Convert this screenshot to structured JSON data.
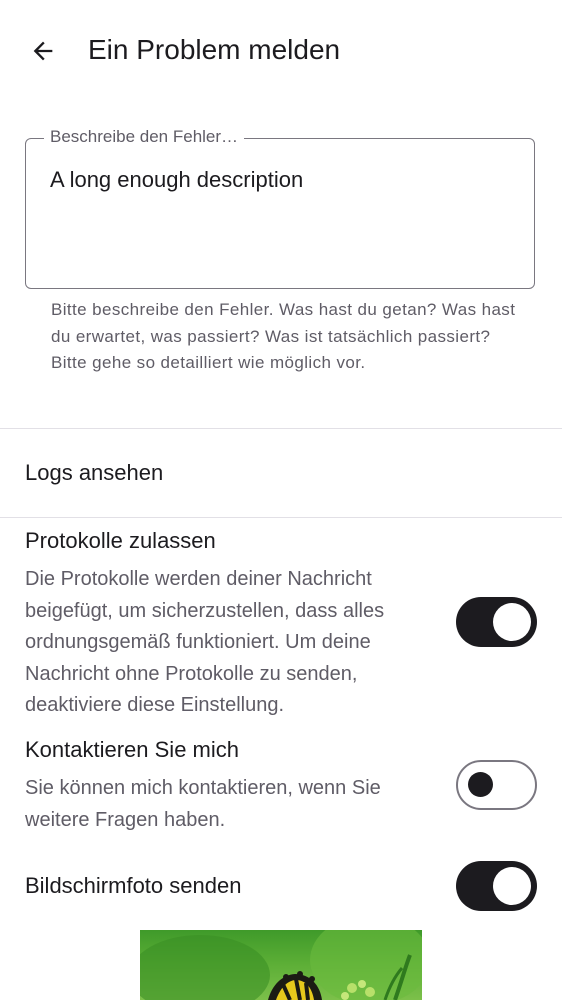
{
  "header": {
    "back_icon": "arrow-left-icon",
    "title": "Ein Problem melden"
  },
  "description_field": {
    "label": "Beschreibe den Fehler…",
    "value": "A long enough description",
    "helper": "Bitte beschreibe den Fehler. Was hast du getan? Was hast du erwartet, was passiert? Was ist tatsächlich passiert? Bitte gehe so detailliert wie möglich vor."
  },
  "logs": {
    "label": "Logs ansehen"
  },
  "settings": {
    "allow_logs": {
      "title": "Protokolle zulassen",
      "description": "Die Protokolle werden deiner Nachricht beigefügt, um sicherzustellen, dass alles ordnungsgemäß funktioniert. Um deine Nachricht ohne Protokolle zu senden, deaktiviere diese Einstellung.",
      "enabled": true
    },
    "contact_me": {
      "title": "Kontaktieren Sie mich",
      "description": "Sie können mich kontaktieren, wenn Sie weitere Fragen haben.",
      "enabled": false
    },
    "send_screenshot": {
      "title": "Bildschirmfoto senden",
      "enabled": true
    }
  },
  "colors": {
    "text_primary": "#1c1b1f",
    "text_secondary": "#5f5c66",
    "outline": "#7a7780",
    "switch_on_track": "#1c1b1f",
    "divider": "#e2e0e6"
  }
}
